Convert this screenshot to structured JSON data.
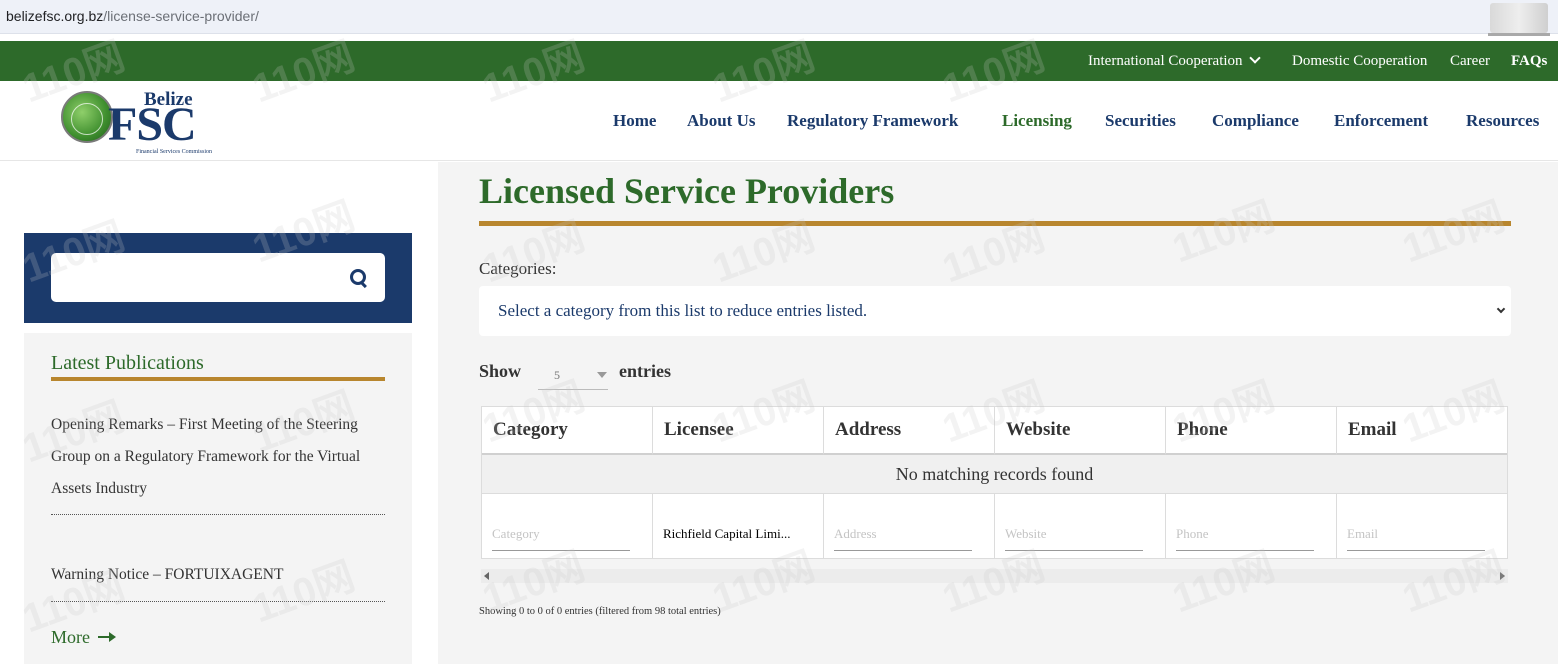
{
  "browser": {
    "url_domain": "belizefsc.org.bz",
    "url_path": "/license-service-provider/"
  },
  "topbar": {
    "international": "International Cooperation",
    "domestic": "Domestic Cooperation",
    "career": "Career",
    "faqs": "FAQs"
  },
  "logo": {
    "belize": "Belize",
    "fsc": "FSC",
    "subtitle": "Financial Services Commission"
  },
  "nav": {
    "home": "Home",
    "about": "About Us",
    "regulatory": "Regulatory Framework",
    "licensing": "Licensing",
    "securities": "Securities",
    "compliance": "Compliance",
    "enforcement": "Enforcement",
    "resources": "Resources"
  },
  "sidebar": {
    "search_value": "",
    "publications_title": "Latest Publications",
    "publications": [
      "Opening Remarks – First Meeting of the Steering Group on a Regulatory Framework for the Virtual Assets Industry",
      "Warning Notice – FORTUIXAGENT"
    ],
    "more": "More"
  },
  "main": {
    "title": "Licensed Service Providers",
    "categories_label": "Categories:",
    "category_select": "Select a category from this list to reduce entries listed.",
    "show": "Show",
    "page_length": "5",
    "entries": "entries",
    "columns": [
      "Category",
      "Licensee",
      "Address",
      "Website",
      "Phone",
      "Email"
    ],
    "empty_message": "No matching records found",
    "filters": {
      "category": {
        "placeholder": "Category",
        "value": ""
      },
      "licensee": {
        "placeholder": "",
        "value": "Richfield Capital Limi..."
      },
      "address": {
        "placeholder": "Address",
        "value": ""
      },
      "website": {
        "placeholder": "Website",
        "value": ""
      },
      "phone": {
        "placeholder": "Phone",
        "value": ""
      },
      "email": {
        "placeholder": "Email",
        "value": ""
      }
    },
    "info": "Showing 0 to 0 of 0 entries (filtered from 98 total entries)"
  },
  "watermark": "110网",
  "colors": {
    "green": "#2d6a2a",
    "navy": "#1b3a6b",
    "gold": "#b8862e"
  }
}
